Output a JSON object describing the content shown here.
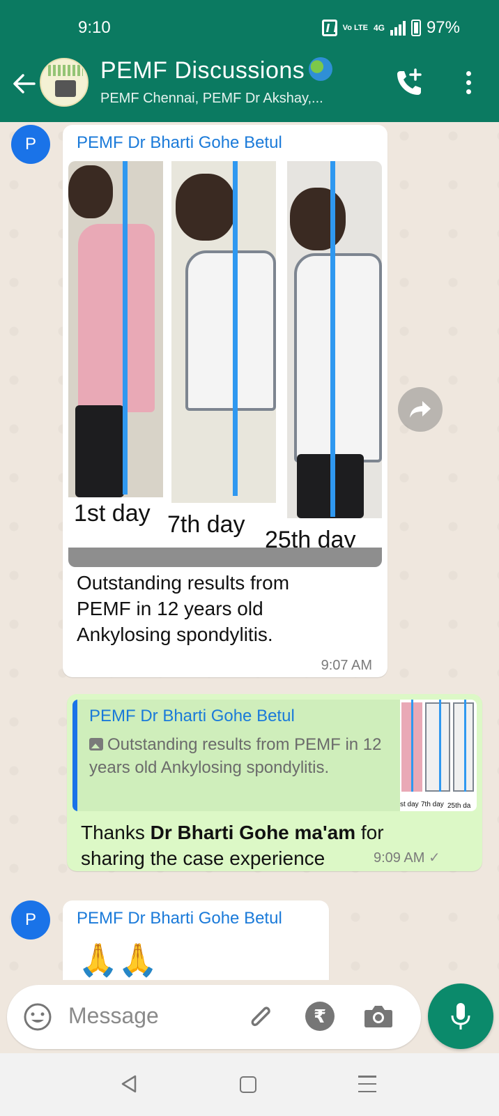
{
  "status_bar": {
    "time": "9:10",
    "network": "4G",
    "volte": "Vo LTE",
    "battery": "97%"
  },
  "header": {
    "title": "PEMF Discussions",
    "subtitle": "PEMF Chennai, PEMF Dr Akshay,..."
  },
  "messages": [
    {
      "avatar_letter": "P",
      "sender": "PEMF Dr Bharti Gohe Betul",
      "photo_labels": [
        "1st day",
        "7th day",
        "25th day"
      ],
      "text_lines": [
        "Outstanding results from",
        "PEMF in 12 years  old",
        "Ankylosing spondylitis."
      ],
      "time": "9:07 AM"
    },
    {
      "quoted_sender": "PEMF Dr Bharti Gohe Betul",
      "quoted_text": "Outstanding results from PEMF in 12 years  old Ankylosing spondylitis.",
      "thumb_labels": [
        "st day",
        "7th day",
        "25th da"
      ],
      "text_before": "Thanks ",
      "text_bold": "Dr Bharti Gohe ma'am",
      "text_after": " for",
      "text_line2": "sharing the case experience",
      "time": "9:09 AM",
      "status": "✓"
    },
    {
      "avatar_letter": "P",
      "sender": "PEMF Dr Bharti Gohe Betul",
      "text": "🙏🙏"
    }
  ],
  "input": {
    "placeholder": "Message",
    "rupee": "₹"
  },
  "colors": {
    "header_bg": "#0b7a61",
    "outgoing_bubble": "#dcf8c6",
    "incoming_bubble": "#ffffff",
    "sender_name": "#1a7ad9",
    "mic_button": "#0b8a6b"
  }
}
